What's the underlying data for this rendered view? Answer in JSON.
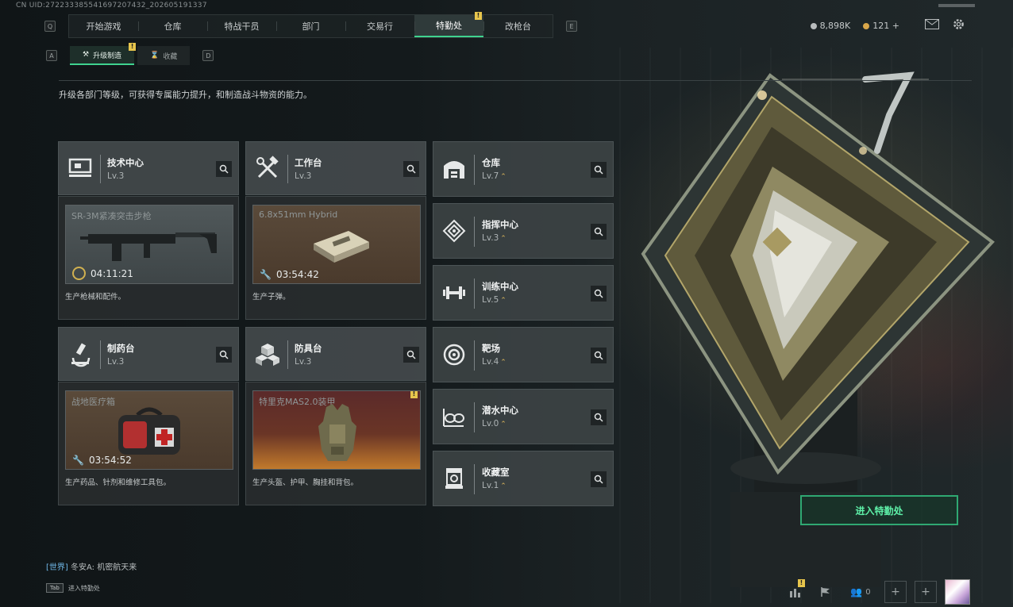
{
  "uid": "CN UID:272233385541697207432_202605191337",
  "nav": {
    "key_left": "Q",
    "key_right": "E",
    "tabs": [
      {
        "label": "开始游戏"
      },
      {
        "label": "仓库"
      },
      {
        "label": "特战干员"
      },
      {
        "label": "部门"
      },
      {
        "label": "交易行"
      },
      {
        "label": "特勤处",
        "active": true,
        "badge": "!"
      },
      {
        "label": "改枪台"
      }
    ]
  },
  "currency": {
    "coins": "8,898K",
    "tokens": "121",
    "add": "+"
  },
  "subtabs": {
    "key_left": "A",
    "key_right": "D",
    "items": [
      {
        "label": "升级制造",
        "active": true,
        "badge": "!"
      },
      {
        "label": "收藏"
      }
    ]
  },
  "description": "升级各部门等级，可获得专属能力提升，和制造战斗物资的能力。",
  "workstations": [
    {
      "name": "技术中心",
      "level": "Lv.3",
      "item": "SR-3M紧凑突击步枪",
      "timer": "04:11:21",
      "footer": "生产枪械和配件。"
    },
    {
      "name": "工作台",
      "level": "Lv.3",
      "item": "6.8x51mm Hybrid",
      "timer": "03:54:42",
      "footer": "生产子弹。"
    },
    {
      "name": "制药台",
      "level": "Lv.3",
      "item": "战地医疗箱",
      "timer": "03:54:52",
      "footer": "生产药品、针剂和维修工具包。"
    },
    {
      "name": "防具台",
      "level": "Lv.3",
      "item": "特里克MAS2.0装甲",
      "timer": "",
      "footer": "生产头盔、护甲、胸挂和背包。"
    }
  ],
  "facilities": [
    {
      "name": "仓库",
      "level": "Lv.7",
      "upgrade": true
    },
    {
      "name": "指挥中心",
      "level": "Lv.3",
      "upgrade": true
    },
    {
      "name": "训练中心",
      "level": "Lv.5",
      "upgrade": true
    },
    {
      "name": "靶场",
      "level": "Lv.4",
      "upgrade": true
    },
    {
      "name": "潜水中心",
      "level": "Lv.0",
      "upgrade": true
    },
    {
      "name": "收藏室",
      "level": "Lv.1",
      "upgrade": true
    }
  ],
  "enter_button": "进入特勤处",
  "chat": {
    "channel": "[世界]",
    "message": "冬安A: 机密航天来"
  },
  "tab_hint": {
    "key": "Tab",
    "label": "进入特勤处"
  },
  "party_count": "0"
}
